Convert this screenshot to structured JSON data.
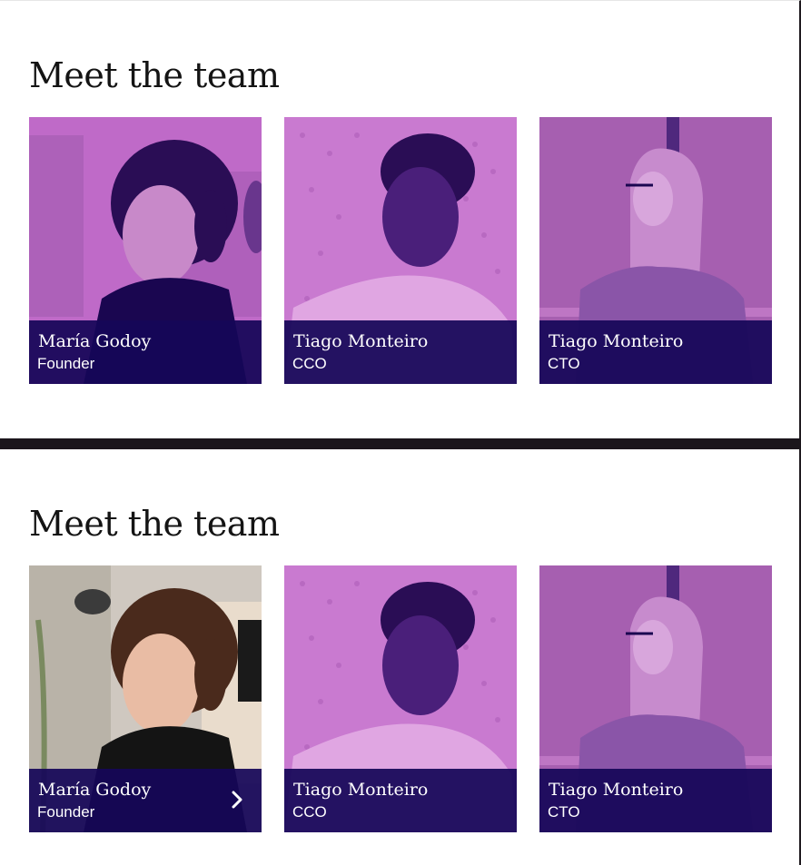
{
  "sections": [
    {
      "heading": "Meet the team",
      "members": [
        {
          "name": "María Godoy",
          "role": "Founder",
          "photo": "woman-portrait-tinted",
          "active": false
        },
        {
          "name": "Tiago Monteiro",
          "role": "CCO",
          "photo": "man-portrait-tinted",
          "active": false
        },
        {
          "name": "Tiago Monteiro",
          "role": "CTO",
          "photo": "woman-hoodie-portrait-tinted",
          "active": false
        }
      ]
    },
    {
      "heading": "Meet the team",
      "members": [
        {
          "name": "María Godoy",
          "role": "Founder",
          "photo": "woman-portrait-color",
          "active": true
        },
        {
          "name": "Tiago Monteiro",
          "role": "CCO",
          "photo": "man-portrait-tinted",
          "active": false
        },
        {
          "name": "Tiago Monteiro",
          "role": "CTO",
          "photo": "woman-hoodie-portrait-tinted",
          "active": false
        }
      ]
    }
  ],
  "colors": {
    "tint": "#c874d0",
    "caption": "#160658",
    "divider": "#1b161c"
  }
}
